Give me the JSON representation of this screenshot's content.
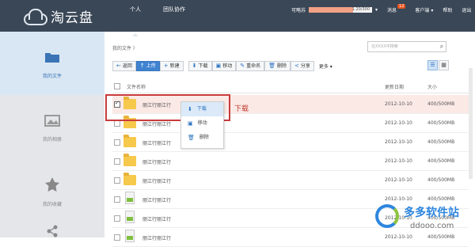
{
  "app": {
    "name": "淘云盘"
  },
  "nav": [
    "个人",
    "团队协作"
  ],
  "user": {
    "name": "可略苏",
    "quota": "1.20/300",
    "messages_label": "消息",
    "messages_count": "12",
    "client": "客户端 ▾",
    "help": "帮助",
    "logout": "退出"
  },
  "sidebar": [
    {
      "label": "我的文件",
      "icon": "folder-icon"
    },
    {
      "label": "我的相册",
      "icon": "photo-icon"
    },
    {
      "label": "我的收藏",
      "icon": "star-icon"
    },
    {
      "label": "",
      "icon": "share-icon"
    }
  ],
  "breadcrumb": "我的文件 〉",
  "search": {
    "placeholder": "在XXXX中搜索"
  },
  "toolbar": [
    {
      "icon": "←",
      "label": "返回"
    },
    {
      "icon": "↑",
      "label": "上传",
      "primary": true
    },
    {
      "icon": "+",
      "label": "新建"
    },
    {
      "icon": "⬇",
      "label": "下载"
    },
    {
      "icon": "▣",
      "label": "移动"
    },
    {
      "icon": "✎",
      "label": "重命名"
    },
    {
      "icon": "🗑",
      "label": "删除"
    },
    {
      "icon": "<",
      "label": "分享"
    }
  ],
  "more_label": "更多 ▾",
  "table": {
    "headers": {
      "name": "文件名称",
      "date": "更新日期",
      "size": "大小"
    },
    "rows": [
      {
        "name": "丽江行丽江行",
        "date": "2012-10-10",
        "size": "400/500MB",
        "type": "folder",
        "checked": true
      },
      {
        "name": "丽江行丽江行",
        "date": "2012-10-10",
        "size": "400/500MB",
        "type": "folder"
      },
      {
        "name": "丽江行丽江行",
        "date": "2012-10-10",
        "size": "400/500MB",
        "type": "folder"
      },
      {
        "name": "丽江行丽江行",
        "date": "2012-10-10",
        "size": "400/500MB",
        "type": "folder"
      },
      {
        "name": "丽江行丽江行",
        "date": "2012-10-10",
        "size": "400/500MB",
        "type": "folder"
      },
      {
        "name": "丽江行丽江行",
        "date": "2012-10-10",
        "size": "400/500MB",
        "type": "file"
      },
      {
        "name": "丽江行丽江行",
        "date": "2012-10-10",
        "size": "400/500MB",
        "type": "file"
      },
      {
        "name": "丽江行丽江行",
        "date": "2012-10-10",
        "size": "400/500MB",
        "type": "file"
      }
    ]
  },
  "context_menu": [
    {
      "icon": "⬇",
      "label": "下载"
    },
    {
      "icon": "▣",
      "label": "移动"
    },
    {
      "icon": "🗑",
      "label": "删除"
    }
  ],
  "annotation": "下载",
  "watermark": {
    "text": "多多软件站",
    "url": "ddooo.com"
  }
}
